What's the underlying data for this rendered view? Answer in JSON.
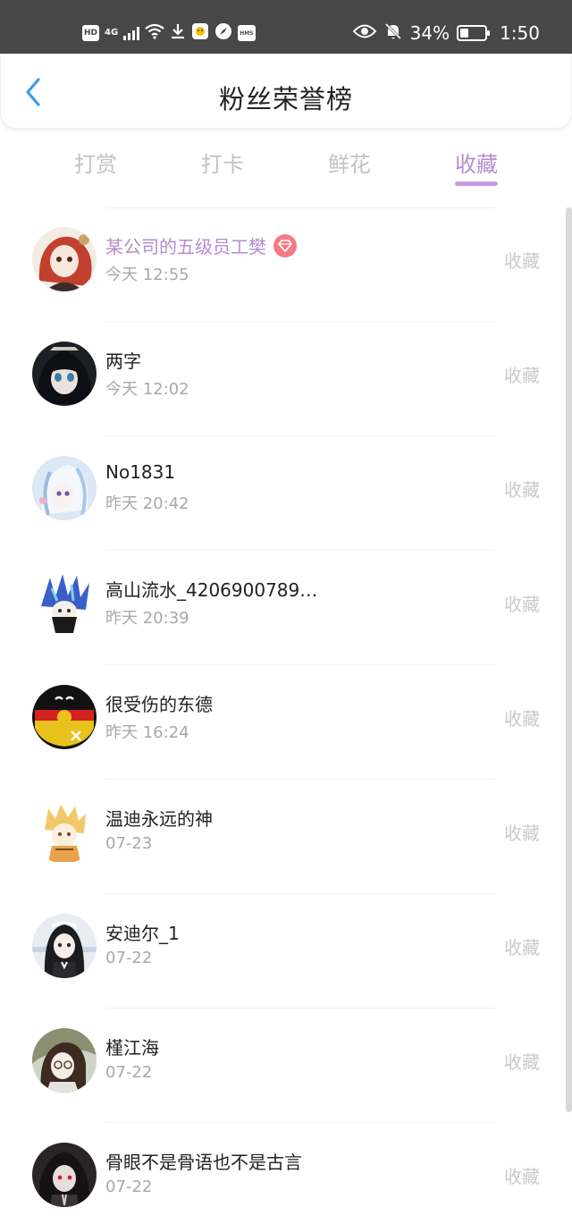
{
  "status_bar": {
    "left_badges": [
      "HD",
      "4G"
    ],
    "battery": "34%",
    "battery_level": 0.34,
    "time": "1:50",
    "icons": [
      "hd-icon",
      "signal-icon",
      "wifi-icon",
      "download-icon",
      "app-notification-icon",
      "compass-icon",
      "hms-icon",
      "eye-icon",
      "bell-off-icon",
      "battery-icon"
    ]
  },
  "header": {
    "title": "粉丝荣誉榜",
    "back_icon": "chevron-left-icon",
    "accent_color": "#3d9be9"
  },
  "tabs": [
    {
      "label": "打赏",
      "active": false
    },
    {
      "label": "打卡",
      "active": false
    },
    {
      "label": "鲜花",
      "active": false
    },
    {
      "label": "收藏",
      "active": true
    }
  ],
  "colors": {
    "active_tab": "#b68bd0",
    "vip_name": "#b68bd0",
    "vip_badge": "#f47a83",
    "muted": "#a8a8a8"
  },
  "list": [
    {
      "name": "某公司的五级员工樊",
      "time": "今天 12:55",
      "tag": "收藏",
      "vip": true
    },
    {
      "name": "两字",
      "time": "今天 12:02",
      "tag": "收藏",
      "vip": false
    },
    {
      "name": "No1831",
      "time": "昨天 20:42",
      "tag": "收藏",
      "vip": false
    },
    {
      "name": "高山流水_4206900789…",
      "time": "昨天 20:39",
      "tag": "收藏",
      "vip": false
    },
    {
      "name": "很受伤的东德",
      "time": "昨天 16:24",
      "tag": "收藏",
      "vip": false
    },
    {
      "name": "温迪永远的神",
      "time": "07-23",
      "tag": "收藏",
      "vip": false
    },
    {
      "name": "安迪尔_1",
      "time": "07-22",
      "tag": "收藏",
      "vip": false
    },
    {
      "name": "槿江海",
      "time": "07-22",
      "tag": "收藏",
      "vip": false
    },
    {
      "name": "骨眼不是骨语也不是古言",
      "time": "07-22",
      "tag": "收藏",
      "vip": false
    }
  ]
}
